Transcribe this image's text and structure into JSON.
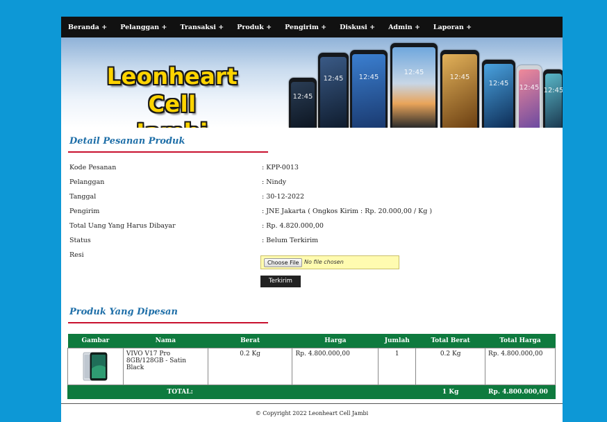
{
  "nav": {
    "items": [
      "Beranda +",
      "Pelanggan +",
      "Transaksi +",
      "Produk +",
      "Pengirim +",
      "Diskusi +",
      "Admin +",
      "Laporan +"
    ]
  },
  "banner": {
    "logo_line1": "Leonheart Cell",
    "logo_line2": "Jambi",
    "phone_clock": "12:45"
  },
  "detail": {
    "heading": "Detail Pesanan Produk",
    "fields": [
      {
        "label": "Kode Pesanan",
        "value": ": KPP-0013"
      },
      {
        "label": "Pelanggan",
        "value": ": Nindy"
      },
      {
        "label": "Tanggal",
        "value": ": 30-12-2022"
      },
      {
        "label": "Pengirim",
        "value": ": JNE Jakarta ( Ongkos Kirim : Rp. 20.000,00 / Kg )"
      },
      {
        "label": "Total Uang Yang Harus Dibayar",
        "value": ": Rp. 4.820.000,00"
      },
      {
        "label": "Status",
        "value": ": Belum Terkirim"
      },
      {
        "label": "Resi",
        "value": ""
      }
    ],
    "file_button": "Choose File",
    "file_status": "No file chosen",
    "submit_label": "Terkirim"
  },
  "products": {
    "heading": "Produk Yang Dipesan",
    "columns": [
      "Gambar",
      "Nama",
      "Berat",
      "Harga",
      "Jumlah",
      "Total Berat",
      "Total Harga"
    ],
    "rows": [
      {
        "nama": "VIVO V17 Pro 8GB/128GB - Satin Black",
        "berat": "0.2 Kg",
        "harga": "Rp. 4.800.000,00",
        "jumlah": "1",
        "total_berat": "0.2 Kg",
        "total_harga": "Rp. 4.800.000,00"
      }
    ],
    "total_label": "TOTAL:",
    "total_berat": "1 Kg",
    "total_harga": "Rp. 4.800.000,00"
  },
  "footer": {
    "copyright": "© Copyright 2022 Leonheart Cell Jambi"
  },
  "colors": {
    "page_bg": "#0d98d6",
    "nav_bg": "#111111",
    "heading": "#1f6fa8",
    "rule": "#c8102e",
    "table_header": "#0e7a3e"
  }
}
